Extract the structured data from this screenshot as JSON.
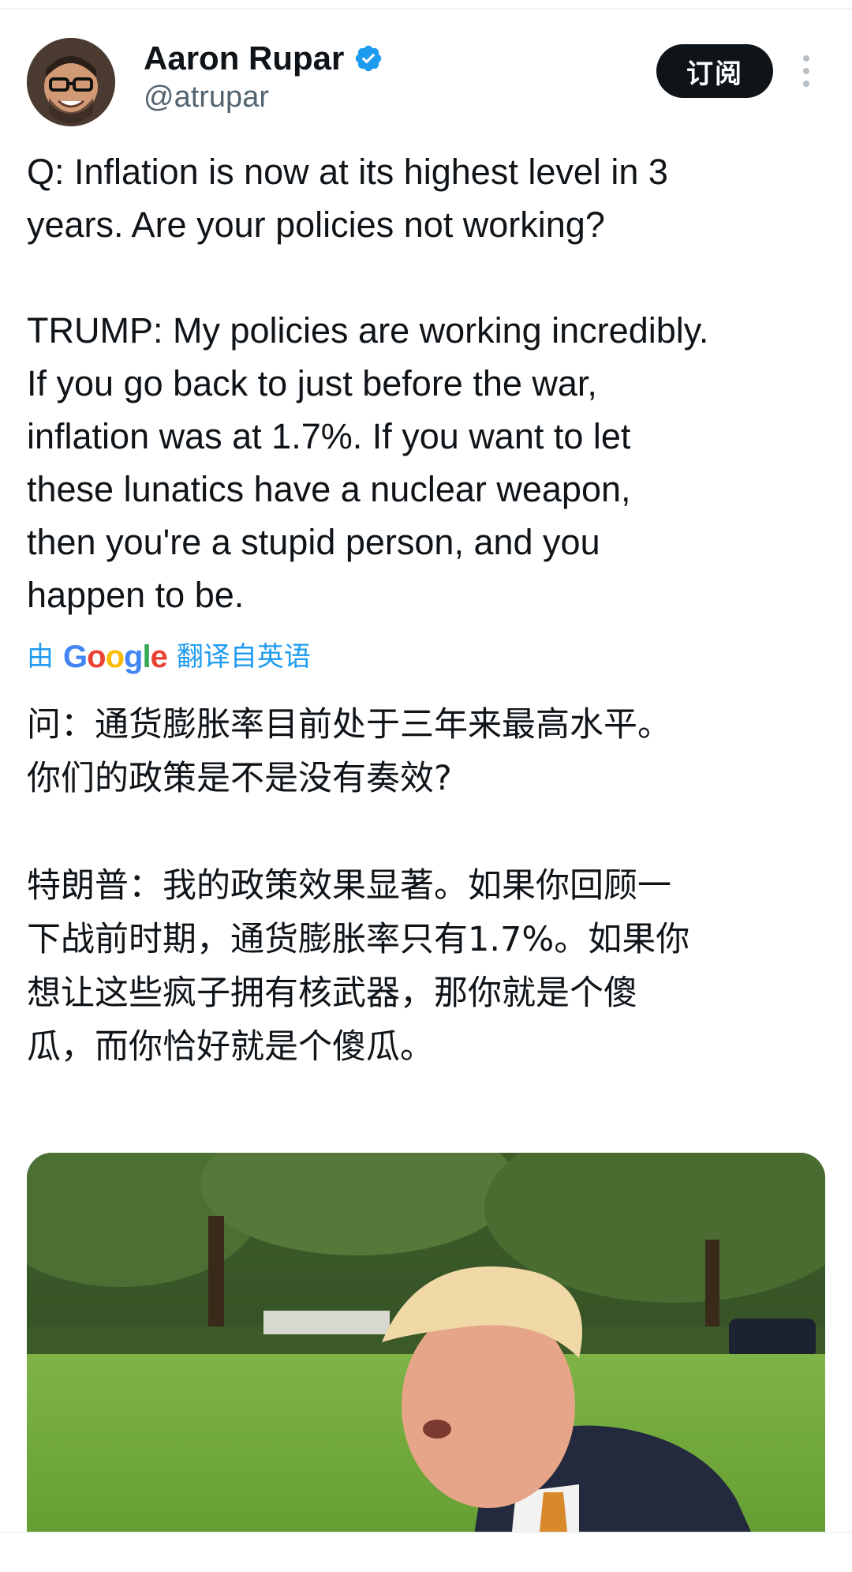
{
  "author": {
    "display_name": "Aaron Rupar",
    "handle": "@atrupar",
    "verified": true
  },
  "actions": {
    "subscribe_label": "订阅",
    "more_icon": "more-vertical-icon"
  },
  "tweet": {
    "text_en": "Q: Inflation is now at its highest level in 3\nyears. Are your policies not working?\n\nTRUMP: My policies are working incredibly.\nIf you go back to just before the war,\ninflation was at 1.7%. If you want to let\nthese lunatics have a nuclear weapon,\nthen you're a stupid person, and you\nhappen to be.",
    "translation_prefix": "由",
    "translation_provider": "Google",
    "translation_suffix": "翻译自英语",
    "text_zh": "问：通货膨胀率目前处于三年来最高水平。\n你们的政策是不是没有奏效?\n\n特朗普：我的政策效果显著。如果你回顾一\n下战前时期，通货膨胀率只有1.7%。如果你\n想让这些疯子拥有核武器，那你就是个傻\n瓜，而你恰好就是个傻瓜。"
  },
  "colors": {
    "accent": "#1d9bf0",
    "text": "#0f1419",
    "secondary": "#536471",
    "button_bg": "#0f1419"
  }
}
